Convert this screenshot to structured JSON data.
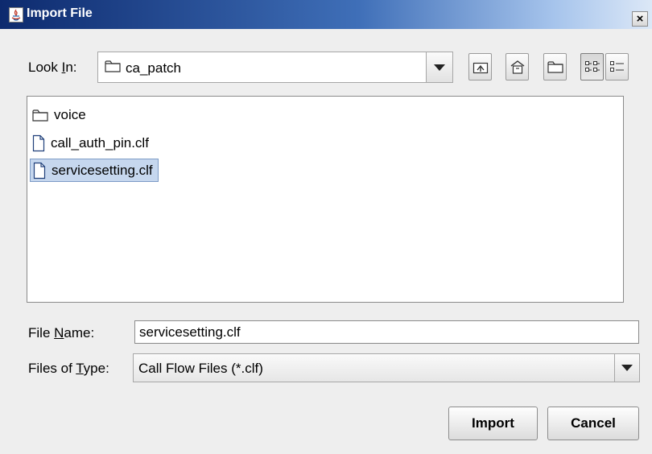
{
  "window": {
    "title": "Import File",
    "close_glyph": "×"
  },
  "look_in": {
    "label_pre": "Look ",
    "label_mnemonic": "I",
    "label_post": "n:",
    "value": "ca_patch"
  },
  "toolbar": {
    "buttons": [
      "up-one-level",
      "home",
      "new-folder",
      "list-view",
      "details-view"
    ]
  },
  "files": [
    {
      "name": "voice",
      "type": "folder",
      "selected": false
    },
    {
      "name": "call_auth_pin.clf",
      "type": "file",
      "selected": false
    },
    {
      "name": "servicesetting.clf",
      "type": "file",
      "selected": true
    }
  ],
  "file_name": {
    "label_pre": "File ",
    "label_mnemonic": "N",
    "label_post": "ame:",
    "value": "servicesetting.clf"
  },
  "file_type": {
    "label_pre": "Files of ",
    "label_mnemonic": "T",
    "label_post": "ype:",
    "value": "Call Flow Files (*.clf)"
  },
  "actions": {
    "import_label": "Import",
    "cancel_label": "Cancel"
  },
  "colors": {
    "titlebar_start": "#0d2a6e",
    "selection": "#c6d7ee"
  }
}
